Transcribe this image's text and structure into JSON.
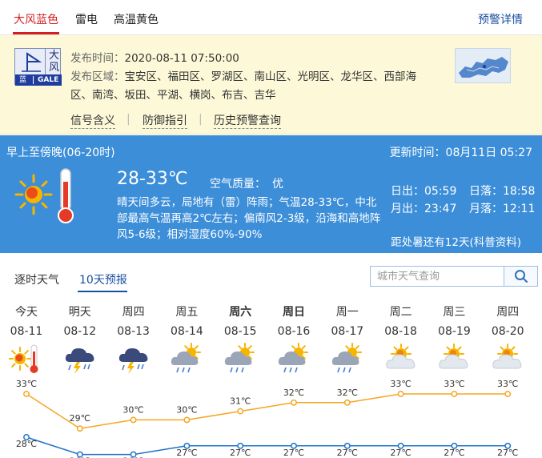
{
  "alert_tabs": [
    {
      "label": "大风蓝色",
      "active": true
    },
    {
      "label": "雷电",
      "active": false
    },
    {
      "label": "高温黄色",
      "active": false
    }
  ],
  "alert_detail_link": "预警详情",
  "alert": {
    "badge_chars": [
      "大",
      "风"
    ],
    "badge_level": "蓝",
    "badge_gale": "GALE",
    "issue_time_label": "发布时间：",
    "issue_time": "2020-08-11 07:50:00",
    "area_label": "发布区域：",
    "area_line1": "宝安区、福田区、罗湖区、南山区、光明区、龙华区、西部海",
    "area_line2": "区、南湾、坂田、平湖、横岗、布吉、吉华",
    "links": [
      "信号含义",
      "防御指引",
      "历史预警查询"
    ]
  },
  "today": {
    "period": "早上至傍晚(06-20时)",
    "updated": "更新时间：08月11日 05:27",
    "temp": "28-33℃",
    "aqi_label": "空气质量：",
    "aqi_value": "优",
    "desc": "晴天间多云，局地有（雷）阵雨；气温28-33℃，中北部最高气温再高2℃左右；偏南风2-3级，沿海和高地阵风5-6级；相对湿度60%-90%",
    "sunrise": "日出：05:59",
    "sunset": "日落：18:58",
    "moonrise": "月出：23:47",
    "moonset": "月落：12:11",
    "countdown": "距处暑还有12天(科普资料)"
  },
  "forecast_tabs": [
    {
      "label": "逐时天气",
      "active": false
    },
    {
      "label": "10天预报",
      "active": true
    }
  ],
  "search": {
    "placeholder": "城市天气查询"
  },
  "forecast": [
    {
      "day": "今天",
      "date": "08-11",
      "icon": "sunny-hot-icon",
      "high": 33,
      "low": 28,
      "weekend": false
    },
    {
      "day": "明天",
      "date": "08-12",
      "icon": "thunderstorm-icon",
      "high": 29,
      "low": 26,
      "weekend": false
    },
    {
      "day": "周四",
      "date": "08-13",
      "icon": "thunderstorm-icon",
      "high": 30,
      "low": 26,
      "weekend": false
    },
    {
      "day": "周五",
      "date": "08-14",
      "icon": "sun-cloud-rain-icon",
      "high": 30,
      "low": 27,
      "weekend": false
    },
    {
      "day": "周六",
      "date": "08-15",
      "icon": "sun-cloud-rain-icon",
      "high": 31,
      "low": 27,
      "weekend": true
    },
    {
      "day": "周日",
      "date": "08-16",
      "icon": "sun-cloud-rain-icon",
      "high": 32,
      "low": 27,
      "weekend": true
    },
    {
      "day": "周一",
      "date": "08-17",
      "icon": "sun-cloud-rain-icon",
      "high": 32,
      "low": 27,
      "weekend": false
    },
    {
      "day": "周二",
      "date": "08-18",
      "icon": "sun-cloud-icon",
      "high": 33,
      "low": 27,
      "weekend": false
    },
    {
      "day": "周三",
      "date": "08-19",
      "icon": "sun-cloud-icon",
      "high": 33,
      "low": 27,
      "weekend": false
    },
    {
      "day": "周四",
      "date": "08-20",
      "icon": "sun-cloud-icon",
      "high": 33,
      "low": 27,
      "weekend": false
    }
  ],
  "temp_unit": "℃",
  "colors": {
    "alert_active": "#d41f1f",
    "link_blue": "#1a4fa0",
    "today_bg": "#3c8ed8",
    "high_line": "#f5a623",
    "low_line": "#1f73c9"
  }
}
